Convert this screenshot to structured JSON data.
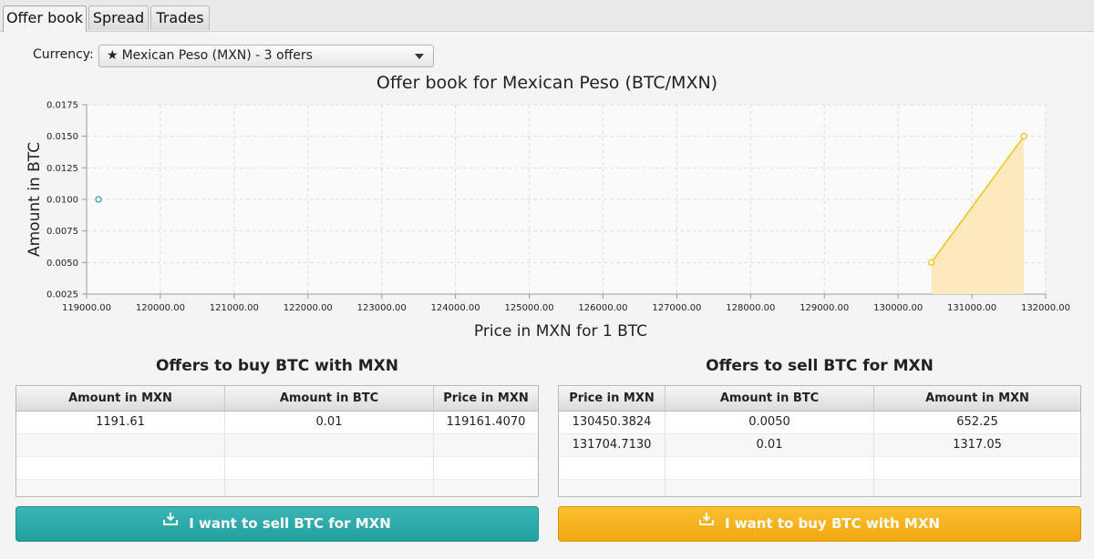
{
  "tabs": [
    {
      "label": "Offer book",
      "active": true
    },
    {
      "label": "Spread",
      "active": false
    },
    {
      "label": "Trades",
      "active": false
    }
  ],
  "currency": {
    "label": "Currency:",
    "selected": "Mexican Peso (MXN) - 3 offers",
    "star_icon": "star-icon"
  },
  "chart_data": {
    "type": "area",
    "title": "Offer book for Mexican Peso (BTC/MXN)",
    "xlabel": "Price in MXN for 1 BTC",
    "ylabel": "Amount in BTC",
    "xlim": [
      119000,
      132000
    ],
    "ylim": [
      0.0025,
      0.0175
    ],
    "x_ticks": [
      "119000.00",
      "120000.00",
      "121000.00",
      "122000.00",
      "123000.00",
      "124000.00",
      "125000.00",
      "126000.00",
      "127000.00",
      "128000.00",
      "129000.00",
      "130000.00",
      "131000.00",
      "132000.00"
    ],
    "y_ticks": [
      "0.0025",
      "0.0050",
      "0.0075",
      "0.0100",
      "0.0125",
      "0.0150",
      "0.0175"
    ],
    "grid": true,
    "series": [
      {
        "color": "#2aa8a4",
        "fill": false,
        "points": [
          {
            "x": 119161.407,
            "y": 0.01
          }
        ]
      },
      {
        "color": "#f0c419",
        "fill": true,
        "fill_color": "#fde9bd",
        "points": [
          {
            "x": 130450.3824,
            "y": 0.005
          },
          {
            "x": 131704.713,
            "y": 0.015
          }
        ]
      }
    ]
  },
  "buy_table": {
    "title": "Offers to buy BTC with MXN",
    "columns": [
      "Amount in MXN",
      "Amount in BTC",
      "Price in MXN"
    ],
    "rows": [
      [
        "1191.61",
        "0.01",
        "119161.4070"
      ]
    ]
  },
  "sell_table": {
    "title": "Offers to sell BTC for MXN",
    "columns": [
      "Price in MXN",
      "Amount in BTC",
      "Amount in MXN"
    ],
    "rows": [
      [
        "130450.3824",
        "0.0050",
        "652.25"
      ],
      [
        "131704.7130",
        "0.01",
        "1317.05"
      ]
    ]
  },
  "buttons": {
    "sell_label": "I want to sell BTC for MXN",
    "buy_label": "I want to buy BTC with MXN",
    "icon": "download-tray-icon",
    "sell_color": "#2aa8a8",
    "buy_color": "#f5b01e"
  }
}
